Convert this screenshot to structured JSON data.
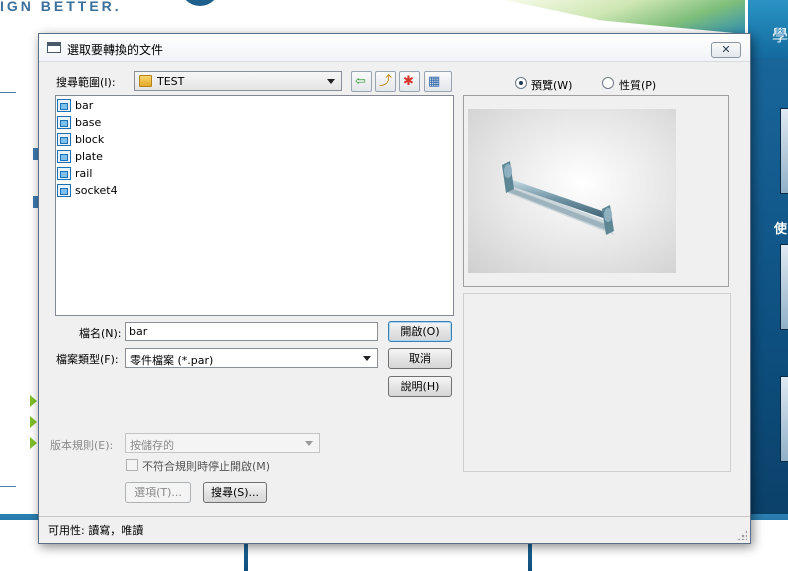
{
  "background": {
    "tagline": "IGN BETTER.",
    "right_text": "學",
    "right_text2": "使"
  },
  "dialog": {
    "title": "選取要轉換的文件",
    "close_glyph": "✕",
    "look_in_label": "搜尋範圍(I):",
    "look_in_value": "TEST",
    "toolbar": {
      "back_glyph": "⇦",
      "up_glyph": "⤴",
      "new_folder_glyph": "✱",
      "views_glyph": "▦"
    },
    "files": [
      "bar",
      "base",
      "block",
      "plate",
      "rail",
      "socket4"
    ],
    "file_name_label": "檔名(N):",
    "file_name_value": "bar",
    "file_type_label": "檔案類型(F):",
    "file_type_value": "零件檔案 (*.par)",
    "open_button": "開啟(O)",
    "cancel_button": "取消",
    "help_button": "說明(H)",
    "revision_rule_label": "版本規則(E):",
    "revision_rule_value": "按儲存的",
    "stop_open_label": "不符合規則時停止開啟(M)",
    "options_button": "選項(T)...",
    "search_button": "搜尋(S)...",
    "preview_radio": "預覽(W)",
    "properties_radio": "性質(P)",
    "status_text": "可用性: 讀寫，唯讀"
  },
  "colors": {
    "accent_blue": "#1e6fb5",
    "web_blue": "#0f4e7c",
    "dialog_bg": "#f0f0f0"
  }
}
